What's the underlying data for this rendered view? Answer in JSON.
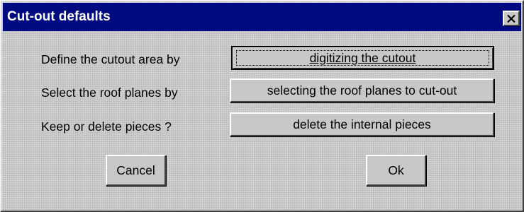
{
  "window": {
    "title": "Cut-out defaults",
    "close_icon": "close-icon"
  },
  "rows": [
    {
      "label": "Define the cutout area by",
      "button_label": "digitizing the cutout"
    },
    {
      "label": "Select the roof planes by",
      "button_label": "selecting the roof planes to cut-out"
    },
    {
      "label": "Keep or delete pieces ?",
      "button_label": "delete the internal pieces"
    }
  ],
  "actions": {
    "cancel_label": "Cancel",
    "ok_label": "Ok"
  },
  "colors": {
    "title_bar": "#000a80",
    "face": "#c8c8c8"
  }
}
